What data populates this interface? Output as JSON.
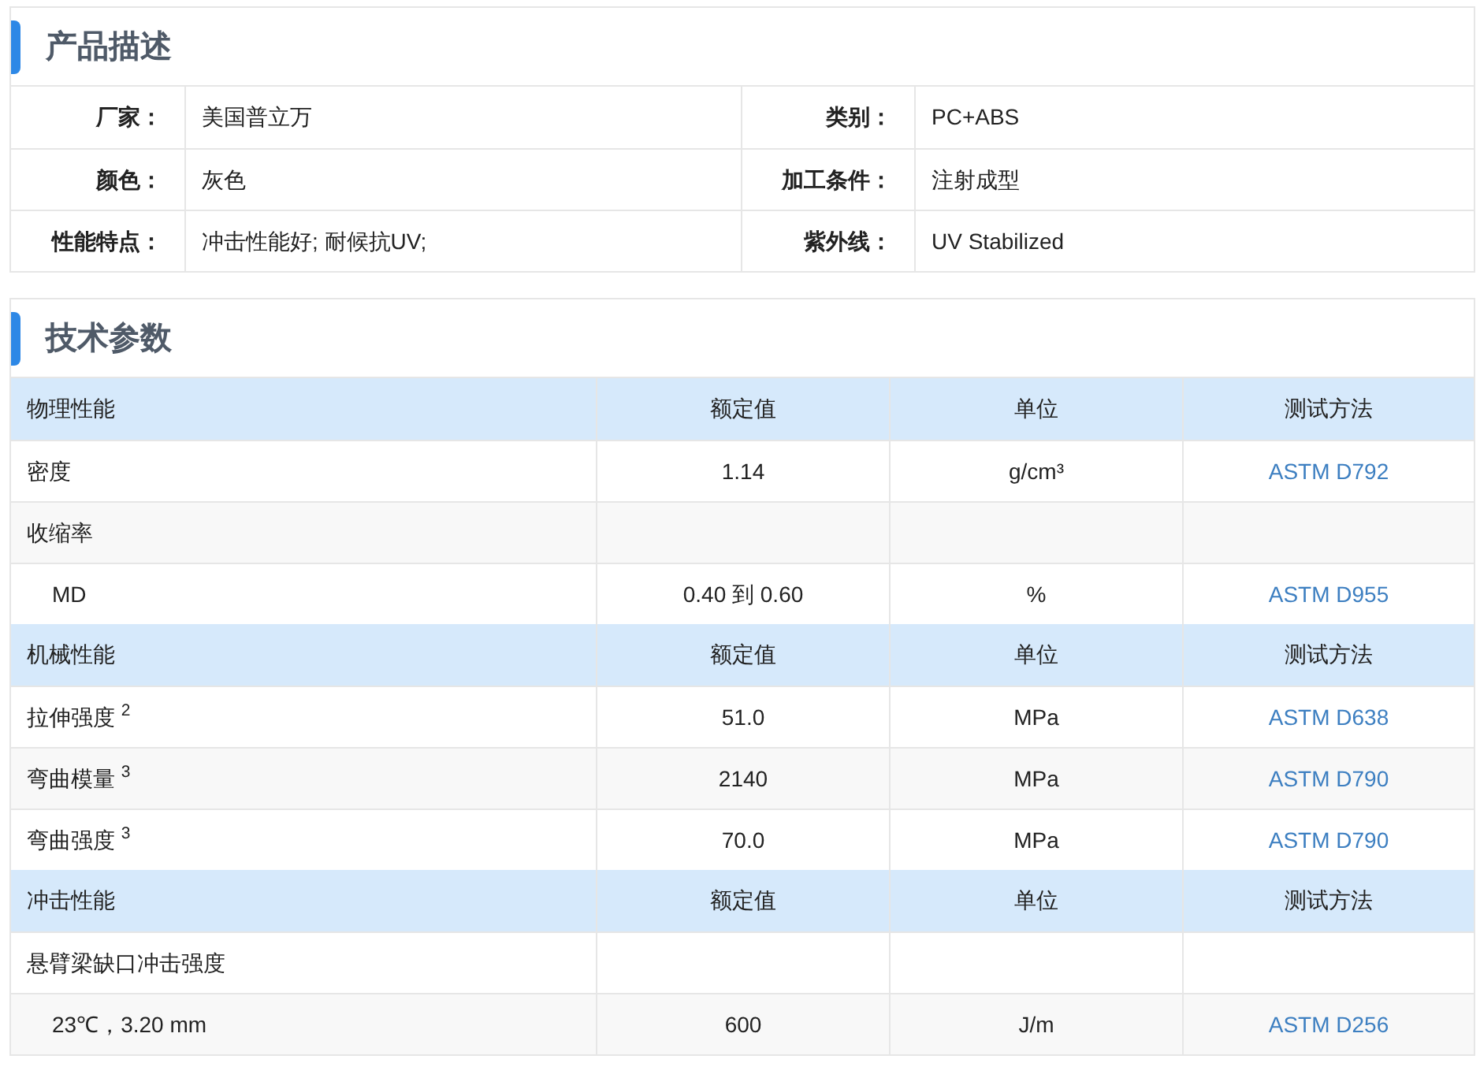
{
  "description": {
    "title": "产品描述",
    "items": [
      {
        "label": "厂家：",
        "value": "美国普立万"
      },
      {
        "label": "类别：",
        "value": "PC+ABS"
      },
      {
        "label": "颜色：",
        "value": "灰色"
      },
      {
        "label": "加工条件：",
        "value": "注射成型"
      },
      {
        "label": "性能特点：",
        "value": "冲击性能好; 耐候抗UV;"
      },
      {
        "label": "紫外线：",
        "value": "UV Stabilized"
      }
    ]
  },
  "tech": {
    "title": "技术参数",
    "groups": [
      {
        "columns": [
          "物理性能",
          "额定值",
          "单位",
          "测试方法"
        ],
        "rows": [
          {
            "name": "密度",
            "value": "1.14",
            "unit": "g/cm³",
            "method": "ASTM D792"
          },
          {
            "name": "收缩率",
            "children": [
              {
                "name": "MD",
                "value": "0.40 到 0.60",
                "unit": "%",
                "method": "ASTM D955"
              }
            ]
          }
        ]
      },
      {
        "columns": [
          "机械性能",
          "额定值",
          "单位",
          "测试方法"
        ],
        "rows": [
          {
            "name": "拉伸强度 $^{2}$",
            "value": "51.0",
            "unit": "MPa",
            "method": "ASTM D638"
          },
          {
            "name": "弯曲模量 $^{3}$",
            "value": "2140",
            "unit": "MPa",
            "method": "ASTM D790"
          },
          {
            "name": "弯曲强度 $^{3}$",
            "value": "70.0",
            "unit": "MPa",
            "method": "ASTM D790"
          }
        ]
      },
      {
        "columns": [
          "冲击性能",
          "额定值",
          "单位",
          "测试方法"
        ],
        "rows": [
          {
            "name": "悬臂梁缺口冲击强度",
            "children": [
              {
                "name": "23℃，3.20 mm",
                "value": "600",
                "unit": "J/m",
                "method": "ASTM D256"
              }
            ]
          }
        ]
      }
    ]
  }
}
